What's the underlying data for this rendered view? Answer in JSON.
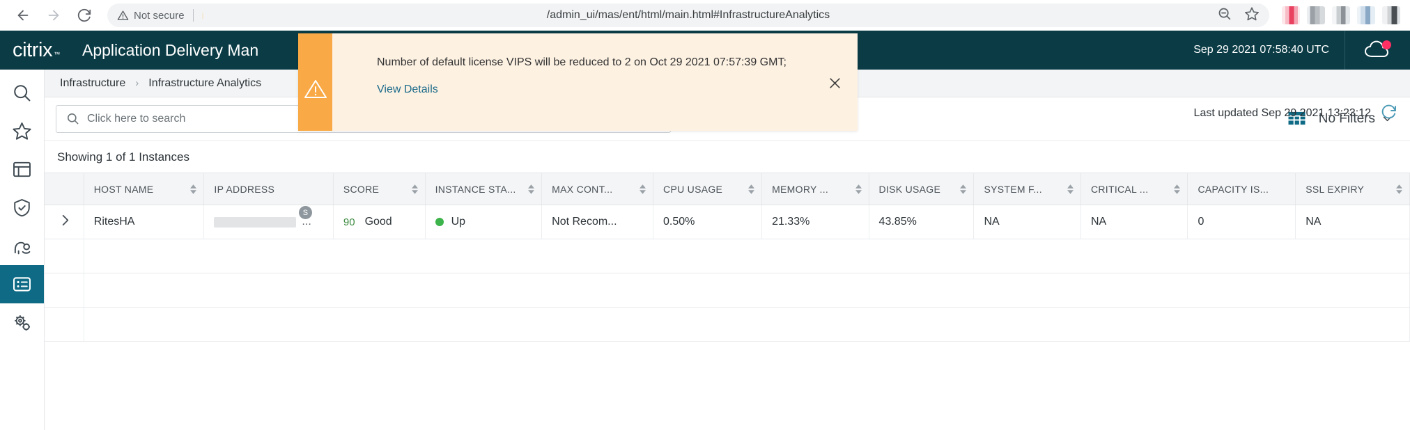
{
  "browser": {
    "back_label": "Back",
    "forward_label": "Forward",
    "reload_label": "Reload",
    "security_label": "Not secure",
    "url": "/admin_ui/mas/ent/html/main.html#InfrastructureAnalytics",
    "ghost_text": "i",
    "zoom_out_icon": "zoom-out-icon",
    "bookmark_icon": "star-icon",
    "extensions": [
      "extension-icon-1",
      "extension-icon-2",
      "extension-icon-3",
      "extension-icon-4",
      "extension-icon-5"
    ]
  },
  "header": {
    "brand": "citrix",
    "brand_tm": "™",
    "title": "Application Delivery Man",
    "datetime": "Sep 29 2021 07:58:40 UTC",
    "cloud_icon": "cloud-icon",
    "brand_color": "#0b3c46",
    "alert_dot_color": "#ff2e63"
  },
  "notification": {
    "icon": "warning-triangle-icon",
    "message": "Number of default license VIPS will be reduced to 2 on Oct 29 2021 07:57:39 GMT;",
    "link_label": "View Details",
    "close_label": "✕",
    "stripe_color": "#f9a945",
    "background_color": "#fdf1e2",
    "link_color": "#1b6b8a"
  },
  "rail": {
    "items": [
      {
        "name": "search",
        "icon": "search-icon",
        "active": false
      },
      {
        "name": "favorites",
        "icon": "star-icon",
        "active": false
      },
      {
        "name": "applications",
        "icon": "window-icon",
        "active": false
      },
      {
        "name": "security",
        "icon": "shield-check-icon",
        "active": false
      },
      {
        "name": "orchestration",
        "icon": "gesture-icon",
        "active": false
      },
      {
        "name": "infrastructure",
        "icon": "list-icon",
        "active": true
      },
      {
        "name": "settings",
        "icon": "gears-icon",
        "active": false
      }
    ],
    "active_color": "#0f6b85"
  },
  "breadcrumb": {
    "items": [
      "Infrastructure",
      "Infrastructure Analytics"
    ],
    "separator": "›"
  },
  "search": {
    "placeholder": "Click here to search",
    "value": "",
    "icon": "search-icon"
  },
  "toolbar": {
    "grid_icon": "table-view-icon",
    "filters_label": "No Filters",
    "filters_chevron": "chevron-down-icon",
    "last_updated": "Last updated Sep 29 2021 13:23:12",
    "refresh_icon": "refresh-icon"
  },
  "content": {
    "showing_label": "Showing 1 of 1 Instances"
  },
  "table": {
    "expander_icon": "chevron-right-icon",
    "sort_icon": "sort-arrows-icon",
    "columns": [
      {
        "label": "HOST NAME",
        "sortable": true
      },
      {
        "label": "IP ADDRESS",
        "sortable": false
      },
      {
        "label": "SCORE",
        "sortable": true
      },
      {
        "label": "INSTANCE STA...",
        "sortable": true
      },
      {
        "label": "MAX CONT...",
        "sortable": true
      },
      {
        "label": "CPU USAGE",
        "sortable": true
      },
      {
        "label": "MEMORY ...",
        "sortable": true
      },
      {
        "label": "DISK USAGE",
        "sortable": true
      },
      {
        "label": "SYSTEM F...",
        "sortable": true
      },
      {
        "label": "CRITICAL ...",
        "sortable": true
      },
      {
        "label": "CAPACITY IS...",
        "sortable": false
      },
      {
        "label": "SSL EXPIRY",
        "sortable": true
      }
    ],
    "rows": [
      {
        "host_name": "RitesHA",
        "ip_address": "",
        "ip_badge": "S",
        "ip_ellipsis": "...",
        "score_value": "90",
        "score_label": "Good",
        "instance_status": "Up",
        "status_color": "#3cb44b",
        "max_content": "Not Recom...",
        "cpu_usage": "0.50%",
        "memory_usage": "21.33%",
        "disk_usage": "43.85%",
        "system_failure": "NA",
        "critical_events": "NA",
        "capacity_issues": "0",
        "ssl_expiry": "NA"
      }
    ],
    "empty_rows": 3
  }
}
